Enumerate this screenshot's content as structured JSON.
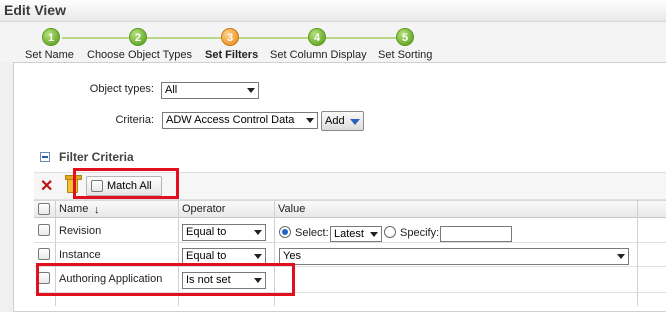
{
  "window": {
    "title": "Edit View"
  },
  "wizard": {
    "steps": [
      {
        "num": "1",
        "label": "Set Name"
      },
      {
        "num": "2",
        "label": "Choose Object Types"
      },
      {
        "num": "3",
        "label": "Set Filters"
      },
      {
        "num": "4",
        "label": "Set Column Display"
      },
      {
        "num": "5",
        "label": "Set Sorting"
      }
    ],
    "active_step": 3
  },
  "form": {
    "object_types_label": "Object types:",
    "object_types_value": "All",
    "criteria_label": "Criteria:",
    "criteria_value": "ADW Access Control Data",
    "add_label": "Add"
  },
  "filter": {
    "title": "Filter Criteria",
    "match_all_label": "Match All",
    "columns": {
      "name": "Name",
      "operator": "Operator",
      "value": "Value"
    },
    "rows": [
      {
        "name": "Revision",
        "operator": "Equal to",
        "select_label": "Select:",
        "select_value": "Latest",
        "specify_label": "Specify:"
      },
      {
        "name": "Instance",
        "operator": "Equal to",
        "value": "Yes"
      },
      {
        "name": "Authoring Application",
        "operator": "Is not set"
      }
    ]
  },
  "colors": {
    "highlight": "#e0101e",
    "step_done": "#4f9a16",
    "step_active": "#e98812",
    "radio": "#1f63c9"
  },
  "icons": [
    "delete-icon",
    "trash-icon",
    "collapse-icon",
    "sort-arrow-icon",
    "dropdown-arrow-icon"
  ]
}
